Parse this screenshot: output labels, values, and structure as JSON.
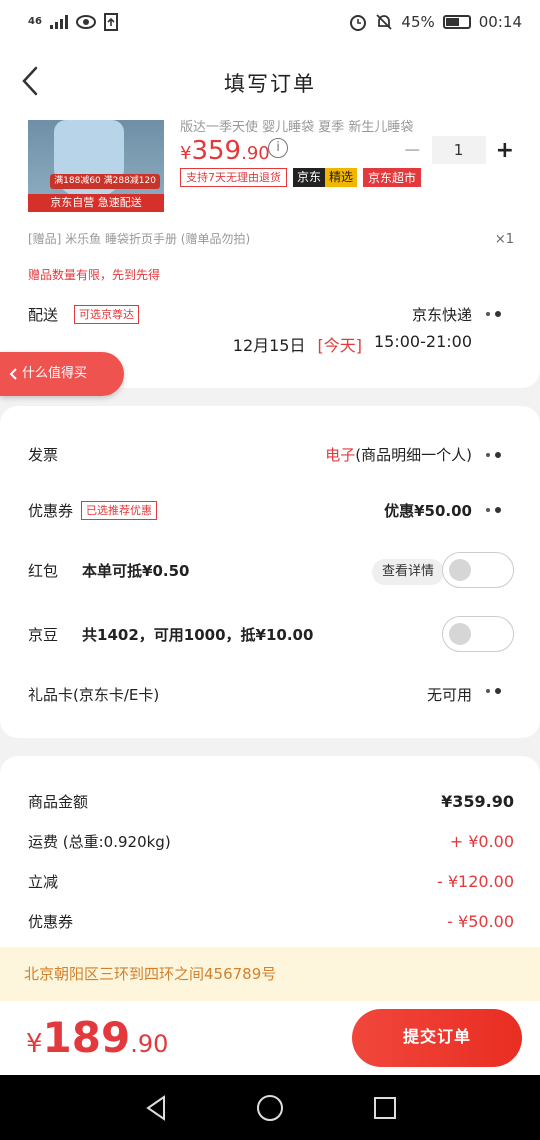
{
  "status": {
    "network": "46",
    "battery": "45%",
    "time": "00:14",
    "icons": [
      "signal-icon",
      "eye-icon",
      "upload-icon",
      "alarm-icon",
      "mute-bell-icon",
      "battery-icon"
    ]
  },
  "header": {
    "title": "填写订单"
  },
  "product": {
    "title_cut": "版达一季天使 婴儿睡袋 夏季 新生儿睡袋",
    "price_yen": "¥",
    "price_int": "359",
    "price_dec": ".90",
    "info": "i",
    "qty_minus": "−",
    "quantity": "1",
    "qty_plus": "+",
    "img_promo": "满188减60 满288减120",
    "img_banner": "京东自营 急速配送",
    "tags": {
      "return": "支持7天无理由退货",
      "jd": "京东",
      "jingxuan": "精选",
      "chaoshi": "京东超市"
    },
    "gift": "[赠品]  米乐鱼 睡袋折页手册 (赠单品勿拍)",
    "gift_qty": "×1",
    "gift_limit": "赠品数量有限，先到先得"
  },
  "shipping": {
    "label": "配送",
    "tag": "可选京尊达",
    "method": "京东快递",
    "date": "12月15日",
    "day": "[今天]",
    "time": "15:00-21:00"
  },
  "side_pill": {
    "label": "什么值得买"
  },
  "options": {
    "invoice": {
      "label": "发票",
      "type": "电子",
      "detail": "(商品明细一个人)"
    },
    "coupon": {
      "label": "优惠券",
      "tag": "已选推荐优惠",
      "value": "优惠¥50.00"
    },
    "redpacket": {
      "label": "红包",
      "text": "本单可抵¥0.50",
      "detail_btn": "查看详情"
    },
    "jingdou": {
      "label": "京豆",
      "text": "共1402，可用1000，抵¥10.00"
    },
    "giftcard": {
      "label": "礼品卡(京东卡/E卡)",
      "value": "无可用"
    }
  },
  "summary": {
    "amount_label": "商品金额",
    "amount": "¥359.90",
    "freight_label": "运费 (总重:0.920kg)",
    "freight": "+ ¥0.00",
    "discount_label": "立减",
    "discount": "- ¥120.00",
    "coupon_label": "优惠券",
    "coupon": "- ¥50.00"
  },
  "address": "北京朝阳区三环到四环之间456789号",
  "bottom": {
    "yen": "¥",
    "total_int": "189",
    "total_dec": ".90",
    "submit": "提交订单"
  },
  "colors": {
    "accent": "#e4393c",
    "address_bg": "#fdf6dc",
    "address_text": "#d4802c"
  }
}
